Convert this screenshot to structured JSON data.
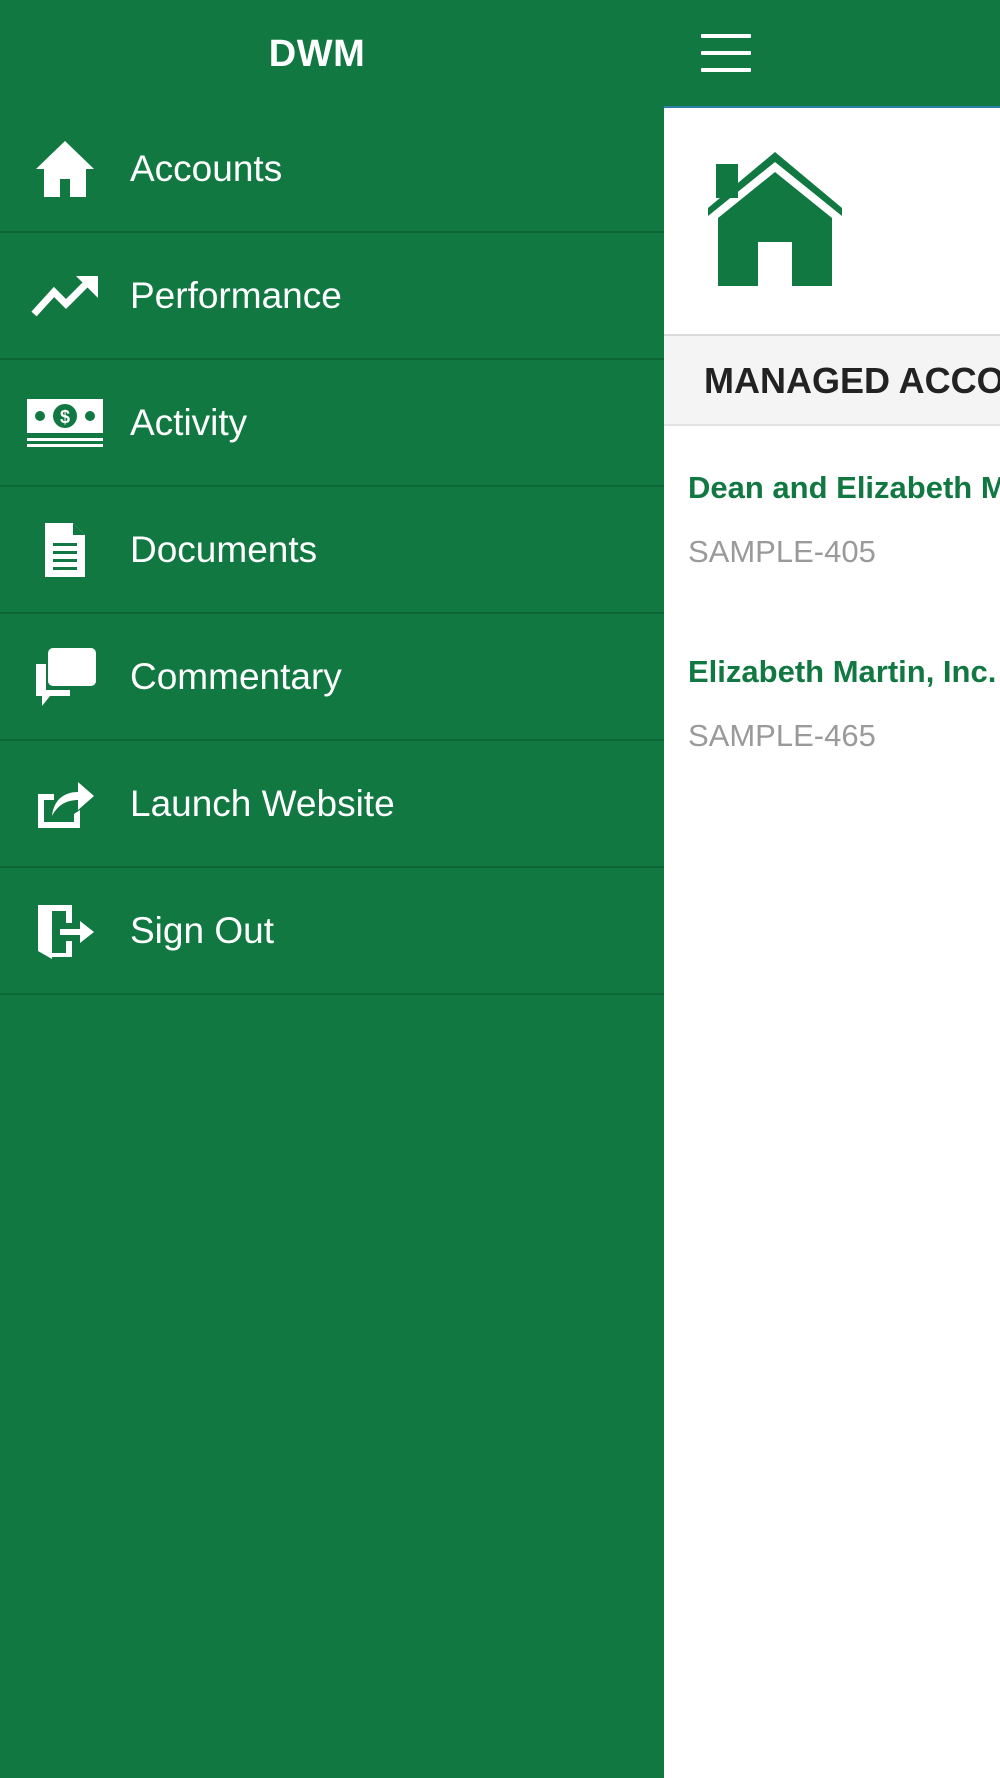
{
  "drawer": {
    "title": "DWM",
    "items": [
      {
        "label": "Accounts",
        "icon": "home-icon"
      },
      {
        "label": "Performance",
        "icon": "trend-up-icon"
      },
      {
        "label": "Activity",
        "icon": "money-icon"
      },
      {
        "label": "Documents",
        "icon": "document-icon"
      },
      {
        "label": "Commentary",
        "icon": "comments-icon"
      },
      {
        "label": "Launch Website",
        "icon": "share-icon"
      },
      {
        "label": "Sign Out",
        "icon": "sign-out-icon"
      }
    ]
  },
  "main": {
    "hero_icon": "home-icon",
    "section_title": "MANAGED ACCOUNTS",
    "accounts": [
      {
        "name": "Dean and Elizabeth Martin",
        "id": "SAMPLE-405"
      },
      {
        "name": "Elizabeth Martin, Inc.",
        "id": "SAMPLE-465"
      }
    ]
  },
  "colors": {
    "brand_green": "#117842",
    "text_gray": "#9a9a9a"
  }
}
